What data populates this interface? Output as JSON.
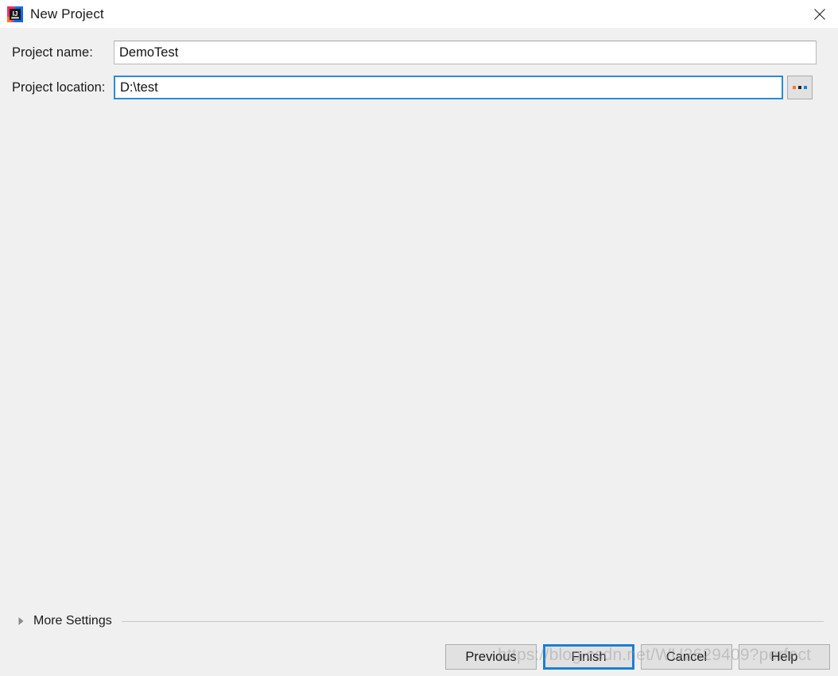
{
  "window": {
    "title": "New Project",
    "app_icon": "intellij-idea-icon",
    "close_icon": "close-icon",
    "background_color": "#f0f0f0",
    "titlebar_color": "#ffffff"
  },
  "form": {
    "fields": [
      {
        "label": "Project name:",
        "value": "DemoTest",
        "placeholder": "",
        "focused": false
      },
      {
        "label": "Project location:",
        "value": "D:\\test",
        "placeholder": "",
        "focused": true
      }
    ],
    "browse_button": {
      "label": "...",
      "dot_colors": [
        "#f07c21",
        "#262626",
        "#1a7fd4"
      ]
    }
  },
  "more_settings": {
    "label": "More Settings",
    "expanded": false,
    "arrow_icon": "chevron-right-icon"
  },
  "buttons": [
    {
      "label": "Previous",
      "default": false
    },
    {
      "label": "Finish",
      "default": true
    },
    {
      "label": "Cancel",
      "default": false
    },
    {
      "label": "Help",
      "default": false
    }
  ],
  "watermark": {
    "text": "https://blog.csdn.net/WU2629409?perfect"
  },
  "colors": {
    "accent": "#1a7fd4",
    "focus_border": "#2a8bd8",
    "button_face": "#e1e1e1",
    "field_border": "#b9b9b9"
  }
}
